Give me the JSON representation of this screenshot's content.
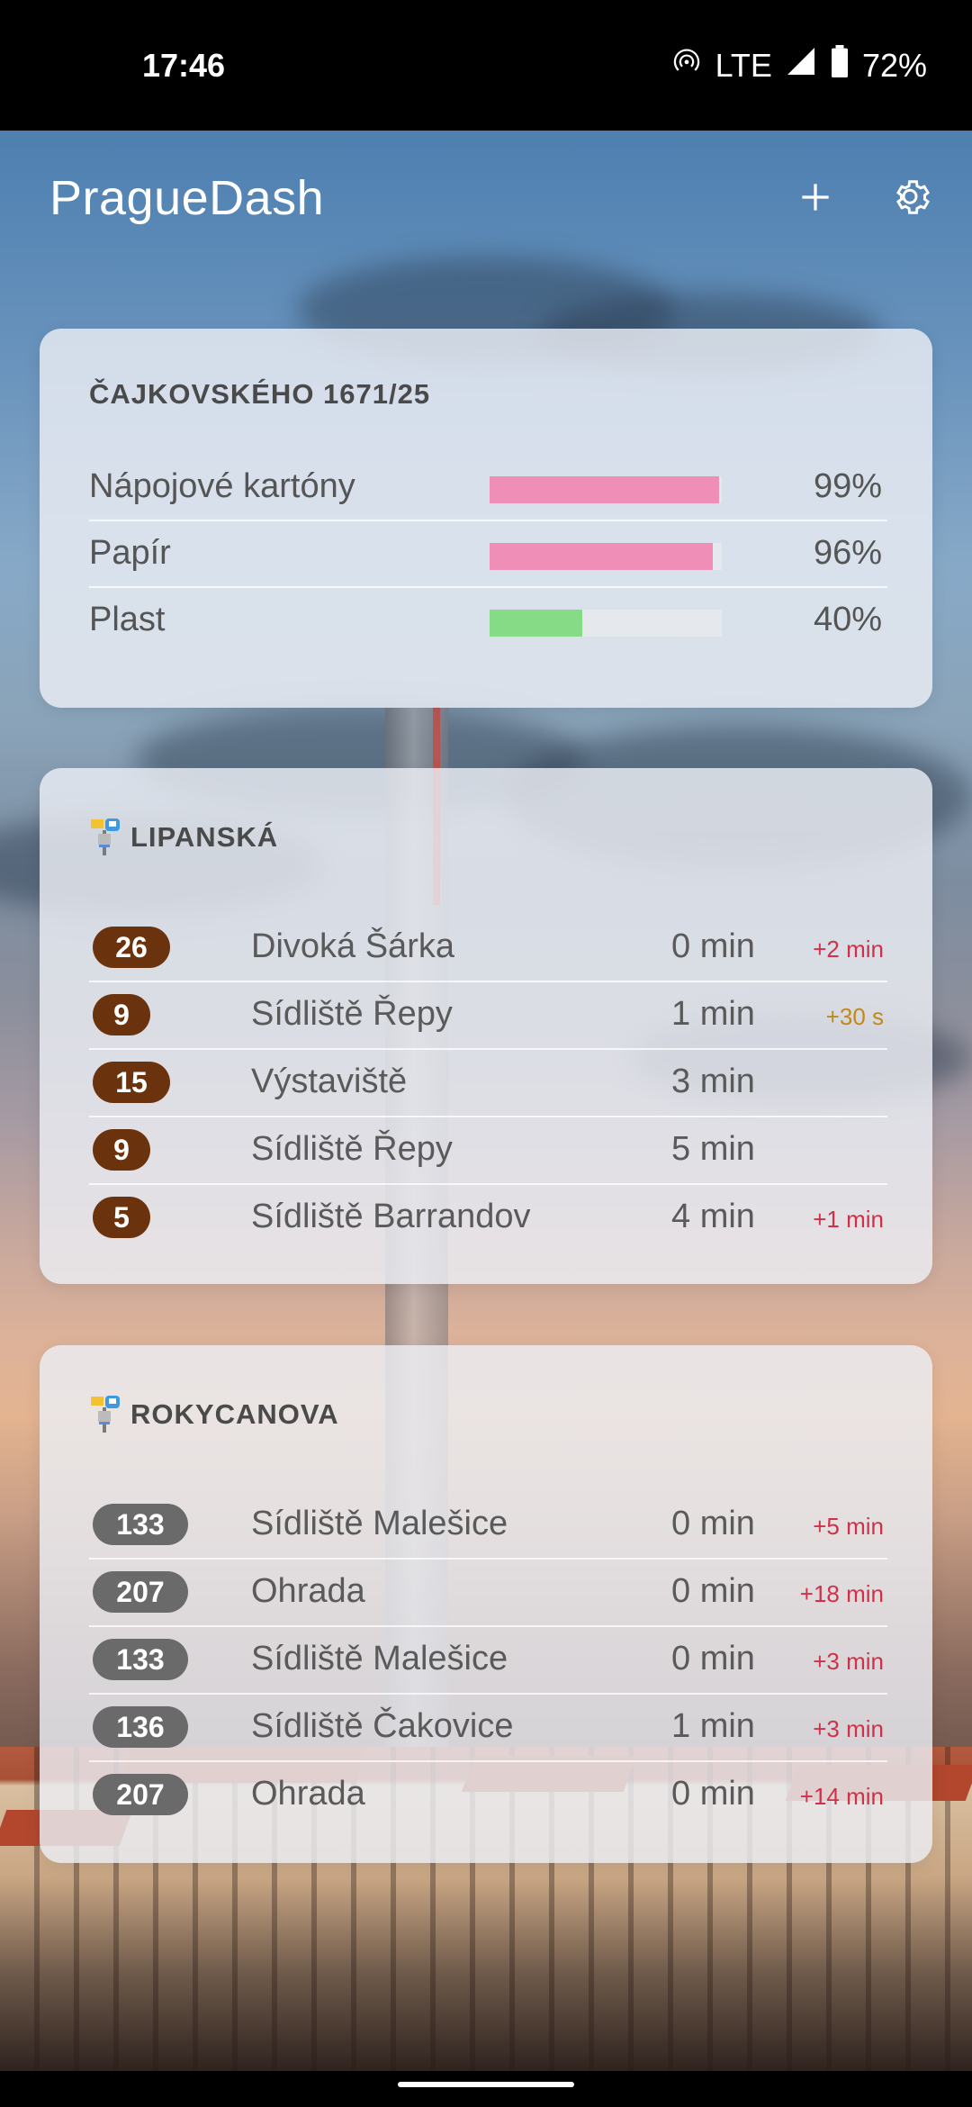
{
  "status_bar": {
    "time": "17:46",
    "network": "LTE",
    "battery": "72%",
    "icons": [
      "hotspot-icon",
      "signal-icon",
      "battery-icon"
    ]
  },
  "app_bar": {
    "title": "PragueDash",
    "add_icon": "plus-icon",
    "settings_icon": "gear-icon"
  },
  "waste_card": {
    "title": "ČAJKOVSKÉHO 1671/25",
    "items": [
      {
        "label": "Nápojové kartóny",
        "fill": 0.99,
        "percent": "99%",
        "color": "#ef8fb8"
      },
      {
        "label": "Papír",
        "fill": 0.96,
        "percent": "96%",
        "color": "#ef8fb8"
      },
      {
        "label": "Plast",
        "fill": 0.4,
        "percent": "40%",
        "color": "#86dc86"
      }
    ]
  },
  "stops": [
    {
      "title": "LIPANSKÁ",
      "icon": "tram-stop-icon",
      "departures": [
        {
          "line": "26",
          "destination": "Divoká Šárka",
          "eta": "0 min",
          "delay": "+2 min",
          "delay_color": "red",
          "type": "tram"
        },
        {
          "line": "9",
          "destination": "Sídliště Řepy",
          "eta": "1 min",
          "delay": "+30 s",
          "delay_color": "amber",
          "type": "tram"
        },
        {
          "line": "15",
          "destination": "Výstaviště",
          "eta": "3 min",
          "delay": "",
          "delay_color": "",
          "type": "tram"
        },
        {
          "line": "9",
          "destination": "Sídliště Řepy",
          "eta": "5 min",
          "delay": "",
          "delay_color": "",
          "type": "tram"
        },
        {
          "line": "5",
          "destination": "Sídliště Barrandov",
          "eta": "4 min",
          "delay": "+1 min",
          "delay_color": "red",
          "type": "tram"
        }
      ]
    },
    {
      "title": "ROKYCANOVA",
      "icon": "bus-stop-icon",
      "departures": [
        {
          "line": "133",
          "destination": "Sídliště Malešice",
          "eta": "0 min",
          "delay": "+5 min",
          "delay_color": "red",
          "type": "bus"
        },
        {
          "line": "207",
          "destination": "Ohrada",
          "eta": "0 min",
          "delay": "+18 min",
          "delay_color": "red",
          "type": "bus"
        },
        {
          "line": "133",
          "destination": "Sídliště Malešice",
          "eta": "0 min",
          "delay": "+3 min",
          "delay_color": "red",
          "type": "bus"
        },
        {
          "line": "136",
          "destination": "Sídliště Čakovice",
          "eta": "1 min",
          "delay": "+3 min",
          "delay_color": "red",
          "type": "bus"
        },
        {
          "line": "207",
          "destination": "Ohrada",
          "eta": "0 min",
          "delay": "+14 min",
          "delay_color": "red",
          "type": "bus"
        }
      ]
    }
  ]
}
